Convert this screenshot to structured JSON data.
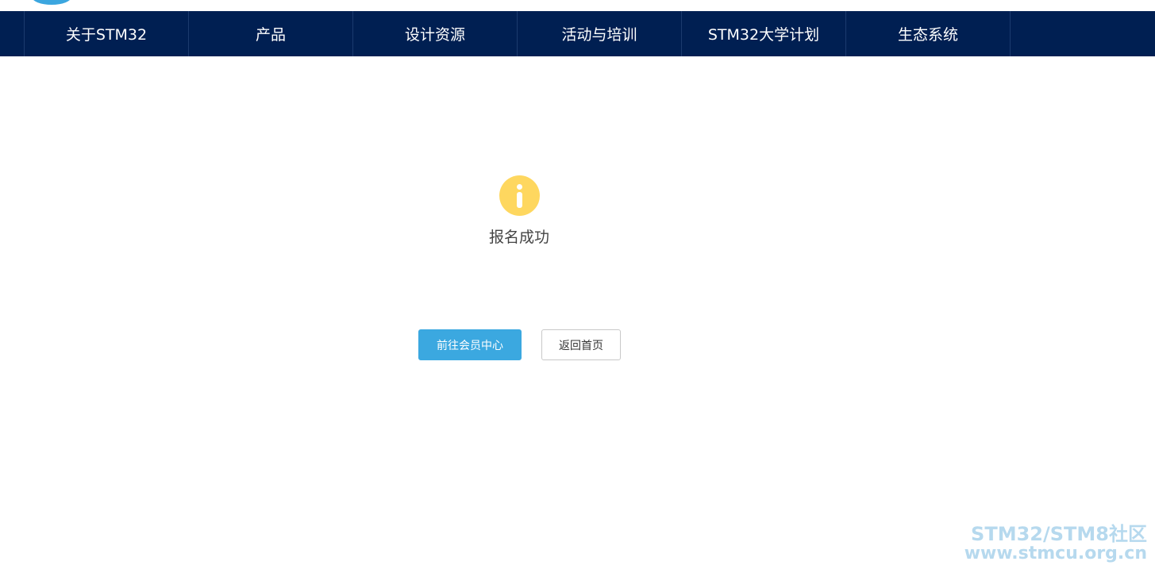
{
  "nav": {
    "items": [
      {
        "label": "关于STM32"
      },
      {
        "label": "产品"
      },
      {
        "label": "设计资源"
      },
      {
        "label": "活动与培训"
      },
      {
        "label": "STM32大学计划"
      },
      {
        "label": "生态系统"
      }
    ]
  },
  "result": {
    "icon": "info-icon",
    "message": "报名成功"
  },
  "actions": {
    "member_center_label": "前往会员中心",
    "home_label": "返回首页"
  },
  "watermark": {
    "line1": "STM32/STM8社区",
    "line2": "www.stmcu.org.cn"
  },
  "colors": {
    "nav_background": "#001f52",
    "primary_button": "#3ba8e0",
    "info_icon": "#fed75f",
    "watermark": "#b6d9ee"
  }
}
